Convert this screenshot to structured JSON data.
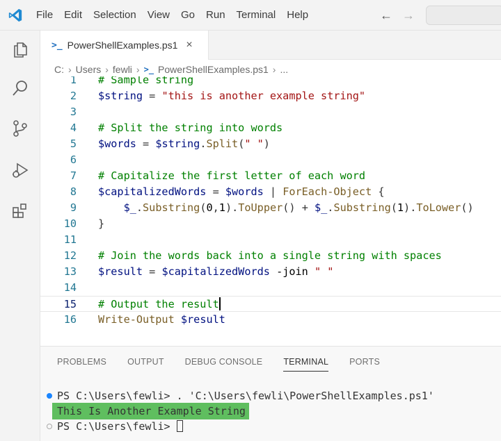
{
  "menu": [
    "File",
    "Edit",
    "Selection",
    "View",
    "Go",
    "Run",
    "Terminal",
    "Help"
  ],
  "nav": {
    "back": "←",
    "forward": "→"
  },
  "tab": {
    "label": "PowerShellExamples.ps1",
    "ps_glyph": ">_",
    "close": "×"
  },
  "breadcrumb": [
    "C:",
    "Users",
    "fewli",
    "PowerShellExamples.ps1",
    "..."
  ],
  "code_lines": [
    {
      "n": "1",
      "text": "# Sample string"
    },
    {
      "n": "2",
      "text": "$string = \"this is another example string\""
    },
    {
      "n": "3",
      "text": ""
    },
    {
      "n": "4",
      "text": "# Split the string into words"
    },
    {
      "n": "5",
      "text": "$words = $string.Split(\" \")"
    },
    {
      "n": "6",
      "text": ""
    },
    {
      "n": "7",
      "text": "# Capitalize the first letter of each word"
    },
    {
      "n": "8",
      "text": "$capitalizedWords = $words | ForEach-Object {"
    },
    {
      "n": "9",
      "text": "    $_.Substring(0,1).ToUpper() + $_.Substring(1).ToLower()"
    },
    {
      "n": "10",
      "text": "}"
    },
    {
      "n": "11",
      "text": ""
    },
    {
      "n": "12",
      "text": "# Join the words back into a single string with spaces"
    },
    {
      "n": "13",
      "text": "$result = $capitalizedWords -join \" \""
    },
    {
      "n": "14",
      "text": ""
    },
    {
      "n": "15",
      "text": "# Output the result"
    },
    {
      "n": "16",
      "text": "Write-Output $result"
    }
  ],
  "panel_tabs": [
    "PROBLEMS",
    "OUTPUT",
    "DEBUG CONSOLE",
    "TERMINAL",
    "PORTS"
  ],
  "active_panel_tab": "TERMINAL",
  "terminal": {
    "line1": "PS C:\\Users\\fewli> . 'C:\\Users\\fewli\\PowerShellExamples.ps1'",
    "output": "This Is Another Example String",
    "line3": "PS C:\\Users\\fewli> "
  },
  "colors": {
    "accent": "#007acc",
    "terminal_output_bg": "#5fbe5f",
    "comment": "#008000",
    "string": "#a31515"
  }
}
